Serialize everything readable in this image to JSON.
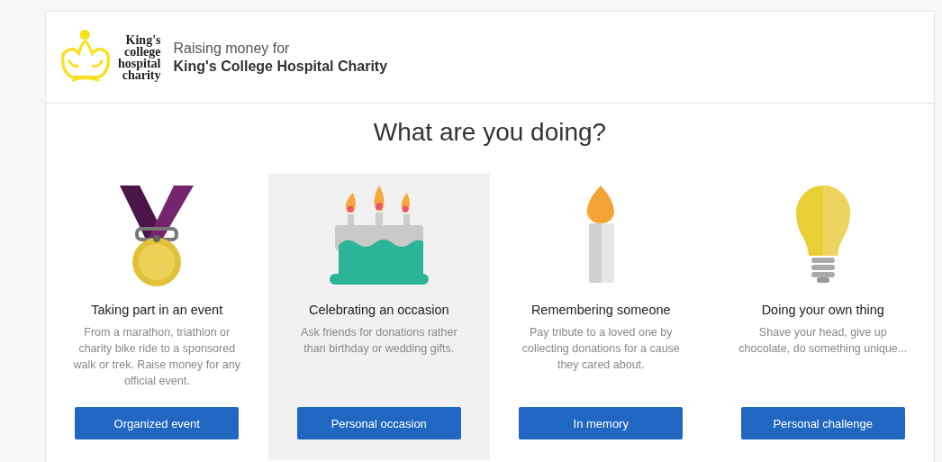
{
  "header": {
    "logo_lines": [
      "King's",
      "college",
      "hospital",
      "charity"
    ],
    "subtitle": "Raising money for",
    "charity_name": "King's College Hospital Charity"
  },
  "heading": "What are you doing?",
  "cards": [
    {
      "kind": "medal",
      "title": "Taking part in an event",
      "description": "From a marathon, triathlon or charity bike ride to a sponsored walk or trek. Raise money for any official event.",
      "button": "Organized event",
      "selected": false
    },
    {
      "kind": "cake",
      "title": "Celebrating an occasion",
      "description": "Ask friends for donations rather than birthday or wedding gifts.",
      "button": "Personal occasion",
      "selected": true
    },
    {
      "kind": "candle",
      "title": "Remembering someone",
      "description": "Pay tribute to a loved one by collecting donations for a cause they cared about.",
      "button": "In memory",
      "selected": false
    },
    {
      "kind": "bulb",
      "title": "Doing your own thing",
      "description": "Shave your head, give up chocolate, do something unique...",
      "button": "Personal challenge",
      "selected": false
    }
  ]
}
